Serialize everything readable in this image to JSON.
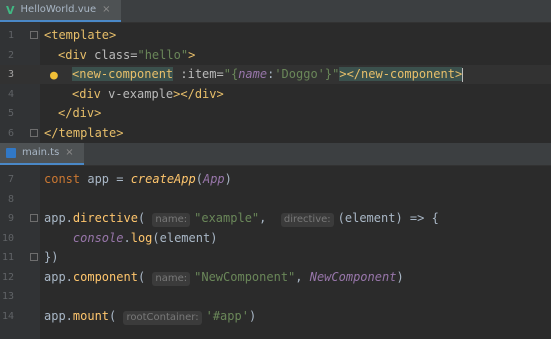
{
  "tabs": {
    "top": {
      "icon": "vue-icon",
      "icon_glyph": "V",
      "icon_color": "#41b883",
      "title": "HelloWorld.vue",
      "close": "×"
    },
    "bottom": {
      "icon": "typescript-file-icon",
      "title": "main.ts",
      "close": "×"
    }
  },
  "editor_top": {
    "lines": [
      {
        "n": "1",
        "parts": [
          [
            "tag",
            "<template>"
          ]
        ]
      },
      {
        "n": "2",
        "parts": [
          [
            "tag",
            "<div"
          ],
          [
            "attr",
            " class="
          ],
          [
            "str",
            "\"hello\""
          ],
          [
            "tag",
            ">"
          ]
        ]
      },
      {
        "n": "3",
        "parts": [
          [
            "tag",
            "<new-component"
          ],
          [
            "attr",
            " :item="
          ],
          [
            "str",
            "\"{"
          ],
          [
            "glob",
            "name"
          ],
          [
            "punc",
            ":"
          ],
          [
            "str",
            "'Doggo'"
          ],
          [
            "str",
            "}\""
          ],
          [
            "tag",
            "></new-component>"
          ]
        ]
      },
      {
        "n": "4",
        "parts": [
          [
            "tag",
            "<div"
          ],
          [
            "attr",
            " v-example"
          ],
          [
            "tag",
            "></div>"
          ]
        ]
      },
      {
        "n": "5",
        "parts": [
          [
            "tag",
            "</div>"
          ]
        ]
      },
      {
        "n": "6",
        "parts": [
          [
            "tag",
            "</template>"
          ]
        ]
      }
    ]
  },
  "editor_bottom": {
    "lines": [
      {
        "n": "7",
        "parts": [
          [
            "kw",
            "const"
          ],
          [
            "punc",
            " app = "
          ],
          [
            "fn",
            "createApp"
          ],
          [
            "punc",
            "("
          ],
          [
            "cls",
            "App"
          ],
          [
            "punc",
            ")"
          ]
        ]
      },
      {
        "n": "8",
        "parts": []
      },
      {
        "n": "9",
        "parts": [
          [
            "punc",
            "app."
          ],
          [
            "method",
            "directive"
          ],
          [
            "punc",
            "( "
          ],
          [
            "hint",
            "name:"
          ],
          [
            "str",
            "\"example\""
          ],
          [
            "punc",
            ",  "
          ],
          [
            "hint",
            "directive:"
          ],
          [
            "punc",
            "(element) => {"
          ]
        ]
      },
      {
        "n": "10",
        "parts": [
          [
            "punc",
            "    "
          ],
          [
            "glob",
            "console"
          ],
          [
            "punc",
            "."
          ],
          [
            "method",
            "log"
          ],
          [
            "punc",
            "(element)"
          ]
        ]
      },
      {
        "n": "11",
        "parts": [
          [
            "punc",
            "})"
          ]
        ]
      },
      {
        "n": "12",
        "parts": [
          [
            "punc",
            "app."
          ],
          [
            "method",
            "component"
          ],
          [
            "punc",
            "( "
          ],
          [
            "hint",
            "name:"
          ],
          [
            "str",
            "\"NewComponent\""
          ],
          [
            "punc",
            ", "
          ],
          [
            "cls",
            "NewComponent"
          ],
          [
            "punc",
            ")"
          ]
        ]
      },
      {
        "n": "13",
        "parts": []
      },
      {
        "n": "14",
        "parts": [
          [
            "punc",
            "app."
          ],
          [
            "method",
            "mount"
          ],
          [
            "punc",
            "( "
          ],
          [
            "hint",
            "rootContainer:"
          ],
          [
            "str",
            "'#app'"
          ],
          [
            "punc",
            ")"
          ]
        ]
      }
    ]
  },
  "colors": {
    "editor_bg": "#2b2b2b",
    "tag": "#e8bf6a",
    "string": "#6a8759",
    "keyword": "#cc7832",
    "function": "#ffc66d",
    "purple": "#9876aa"
  },
  "icons": {
    "intention_bulb": "lightbulb-icon"
  }
}
